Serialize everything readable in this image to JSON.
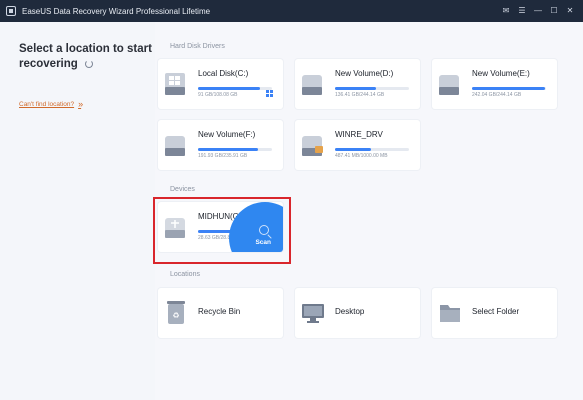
{
  "titlebar": {
    "title": "EaseUS Data Recovery Wizard Professional Lifetime",
    "controls": [
      "✉",
      "☰",
      "—",
      "☐",
      "✕"
    ]
  },
  "left": {
    "headline": "Select a location to start recovering",
    "cant_find": "Can't find location?"
  },
  "sections": {
    "hdd": "Hard Disk Drivers",
    "devices": "Devices",
    "locations": "Locations"
  },
  "hard_disks": [
    {
      "name": "Local Disk(C:)",
      "size": "91 GB/108.08 GB",
      "usage": 0.84
    },
    {
      "name": "New Volume(D:)",
      "size": "136.41 GB/244.14 GB",
      "usage": 0.56
    },
    {
      "name": "New Volume(E:)",
      "size": "242.04 GB/244.14 GB",
      "usage": 0.99
    },
    {
      "name": "New Volume(F:)",
      "size": "191.93 GB/235.91 GB",
      "usage": 0.81
    },
    {
      "name": "WINRE_DRV",
      "size": "487.41 MB/1000.00 MB",
      "usage": 0.49
    }
  ],
  "devices": [
    {
      "name": "MIDHUN(G:)",
      "size": "28.63 GB/28.84 GB",
      "usage": 0.99,
      "action": "Scan"
    }
  ],
  "locations": [
    {
      "name": "Recycle Bin"
    },
    {
      "name": "Desktop"
    },
    {
      "name": "Select Folder"
    }
  ],
  "colors": {
    "accent": "#3b82f6",
    "titlebar": "#1f2a3c",
    "highlight": "#d9262c",
    "link": "#d16a2a"
  }
}
